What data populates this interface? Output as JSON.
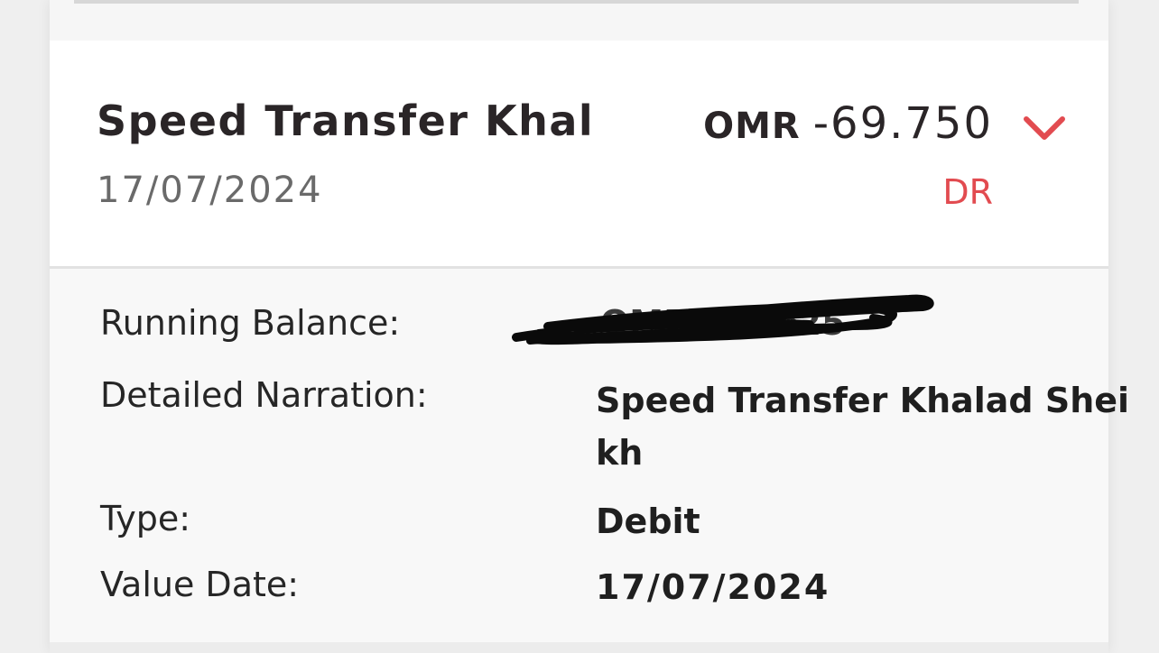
{
  "transaction": {
    "title": "Speed Transfer Khal",
    "date": "17/07/2024",
    "currency": "OMR",
    "amount": "-69.750",
    "drcr": "DR",
    "drcr_color": "#e24b50",
    "expand_icon": "chevron-down-icon"
  },
  "details": {
    "running_balance_label": "Running Balance:",
    "running_balance_value": "OMR 7****25",
    "narration_label": "Detailed Narration:",
    "narration_line1": "Speed Transfer Khalad Shei",
    "narration_line2": "kh",
    "type_label": "Type:",
    "type_value": "Debit",
    "value_date_label": "Value Date:",
    "value_date_value": "17/07/2024"
  }
}
